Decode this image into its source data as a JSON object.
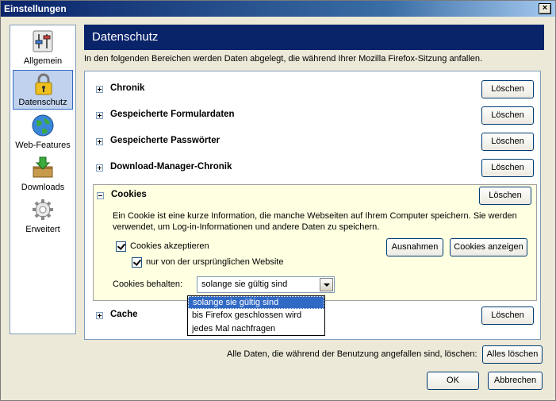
{
  "window": {
    "title": "Einstellungen",
    "close_glyph": "×"
  },
  "sidebar": {
    "items": [
      {
        "label": "Allgemein",
        "icon": "switches-icon"
      },
      {
        "label": "Datenschutz",
        "icon": "padlock-icon",
        "selected": true
      },
      {
        "label": "Web-Features",
        "icon": "globe-icon"
      },
      {
        "label": "Downloads",
        "icon": "download-box-icon"
      },
      {
        "label": "Erweitert",
        "icon": "gear-icon"
      }
    ]
  },
  "main": {
    "header": "Datenschutz",
    "intro": "In den folgenden Bereichen werden Daten abgelegt, die während Ihrer Mozilla Firefox-Sitzung anfallen.",
    "delete_label": "Löschen",
    "sections": [
      {
        "title": "Chronik"
      },
      {
        "title": "Gespeicherte Formulardaten"
      },
      {
        "title": "Gespeicherte Passwörter"
      },
      {
        "title": "Download-Manager-Chronik"
      },
      {
        "title": "Cookies",
        "expanded": true
      },
      {
        "title": "Cache"
      }
    ],
    "cookies": {
      "description": "Ein Cookie ist eine kurze Information, die manche Webseiten auf Ihrem Computer speichern. Sie werden verwendet, um Log-in-Informationen und andere Daten zu speichern.",
      "accept_label": "Cookies akzeptieren",
      "accept_checked": true,
      "origin_only_label": "nur von der ursprünglichen Website",
      "origin_only_checked": true,
      "exceptions_button": "Ausnahmen",
      "show_button": "Cookies anzeigen",
      "keep_label": "Cookies behalten:",
      "keep_value": "solange sie gültig sind",
      "keep_options": [
        "solange sie gültig sind",
        "bis Firefox geschlossen wird",
        "jedes Mal nachfragen"
      ]
    },
    "footer_text": "Alle Daten, die während der Benutzung angefallen sind, löschen:",
    "clear_all_button": "Alles löschen"
  },
  "buttons": {
    "ok": "OK",
    "cancel": "Abbrechen"
  }
}
